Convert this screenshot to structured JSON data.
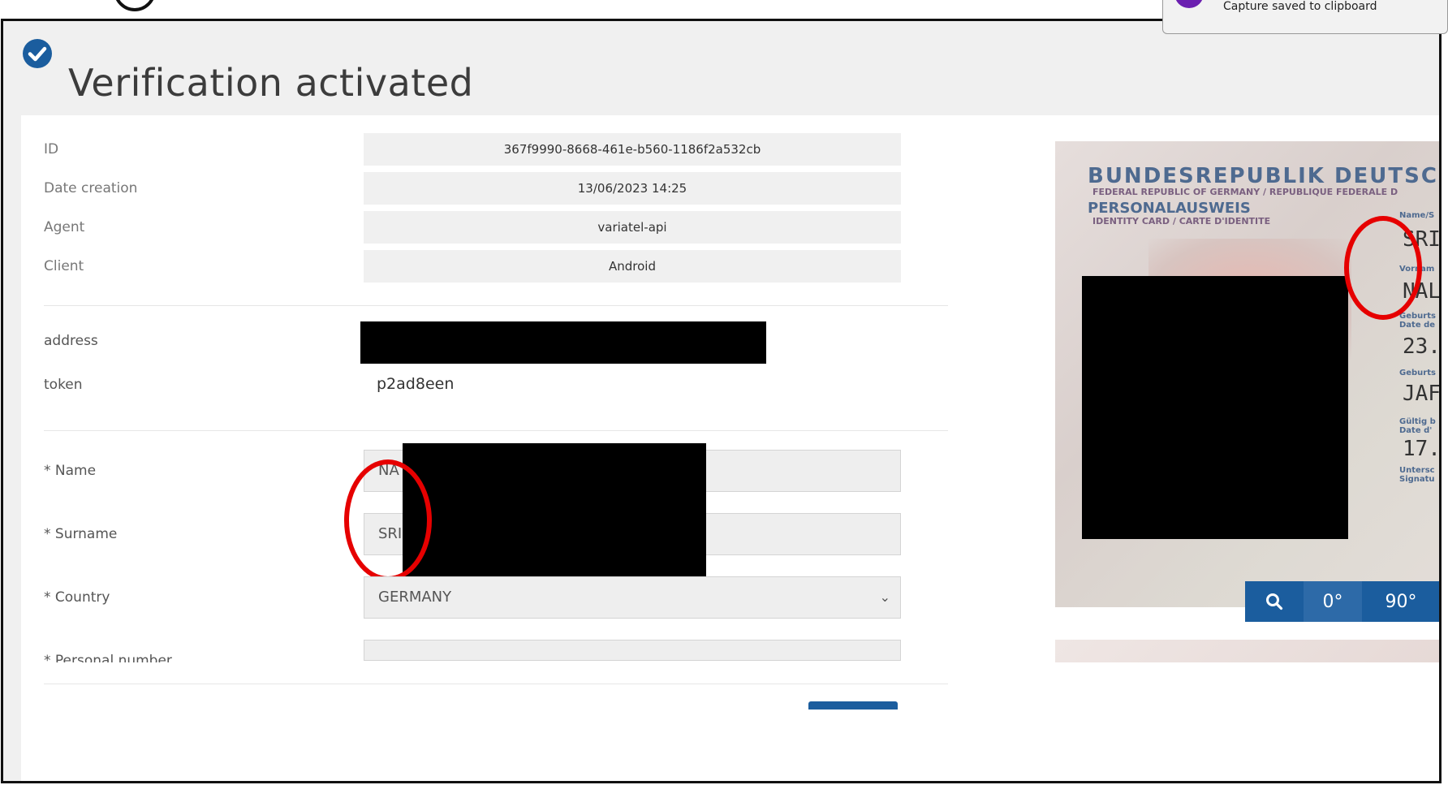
{
  "toast": {
    "message": "Capture saved to clipboard"
  },
  "page": {
    "title": "Verification activated"
  },
  "details": [
    {
      "label": "ID",
      "value": "367f9990-8668-461e-b560-1186f2a532cb"
    },
    {
      "label": "Date creation",
      "value": "13/06/2023 14:25"
    },
    {
      "label": "Agent",
      "value": "variatel-api"
    },
    {
      "label": "Client",
      "value": "Android"
    }
  ],
  "extra": {
    "address_label": "address",
    "token_label": "token",
    "token_value": "p2ad8een"
  },
  "form": {
    "name_label": "* Name",
    "name_value": "NA",
    "surname_label": "* Surname",
    "surname_value": "SRI",
    "country_label": "* Country",
    "country_value": "GERMANY",
    "personal_number_label": "* Personal number"
  },
  "id_card": {
    "line1": "BUNDESREPUBLIK DEUTSCH",
    "line2": "FEDERAL REPUBLIC OF GERMANY / REPUBLIQUE FEDERALE D",
    "line3": "PERSONALAUSWEIS",
    "line4": "IDENTITY CARD / CARTE D'IDENTITE",
    "fields": [
      {
        "small": "Name/S",
        "big": "SRI"
      },
      {
        "small": "Vornam",
        "big": "NAL"
      },
      {
        "small": "Geburts Date de",
        "big": "23."
      },
      {
        "small": "Geburts",
        "big": "JAF"
      },
      {
        "small": "Gültig b Date d'",
        "big": "17."
      },
      {
        "small": "Untersc Signatu",
        "big": ""
      }
    ]
  },
  "rotate": {
    "zoom_icon": "magnifier-icon",
    "deg0": "0°",
    "deg90": "90°"
  },
  "colors": {
    "accent": "#1b5d9e",
    "check": "#1b5d9e",
    "highlight": "#e60000"
  }
}
